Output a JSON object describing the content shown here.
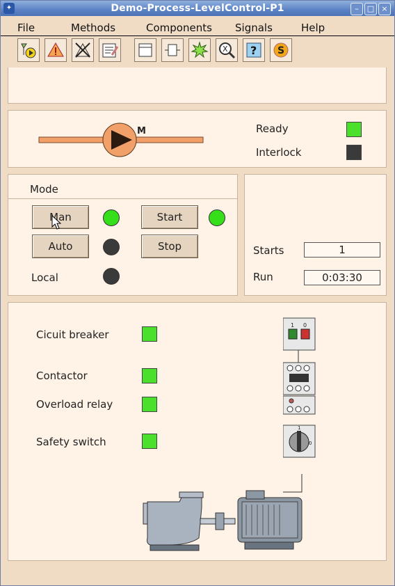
{
  "window": {
    "title": "Demo-Process-LevelControl-P1"
  },
  "menubar": {
    "file": "File",
    "methods": "Methods",
    "components": "Components",
    "signals": "Signals",
    "help": "Help"
  },
  "toolbar": {
    "icons": [
      "trend-icon",
      "alarm-icon",
      "blocked-icon",
      "note-icon",
      "graph-icon",
      "object-icon",
      "sim-icon",
      "crossref-icon",
      "help-icon",
      "s-icon"
    ]
  },
  "pump": {
    "motor_label": "M"
  },
  "status": {
    "ready_label": "Ready",
    "interlock_label": "Interlock",
    "ready_color": "#4be02c",
    "interlock_color": "#3a3a3a"
  },
  "mode": {
    "heading": "Mode",
    "man_label": "Man",
    "auto_label": "Auto",
    "start_label": "Start",
    "stop_label": "Stop",
    "local_label": "Local"
  },
  "counters": {
    "starts_label": "Starts",
    "starts_value": "1",
    "run_label": "Run",
    "run_value": "0:03:30"
  },
  "signals": {
    "circuit_breaker": "Cicuit breaker",
    "contactor": "Contactor",
    "overload_relay": "Overload relay",
    "safety_switch": "Safety switch"
  },
  "devices": {
    "breaker_on": "1",
    "breaker_off": "0",
    "switch_off": "0",
    "switch_on": "1"
  }
}
